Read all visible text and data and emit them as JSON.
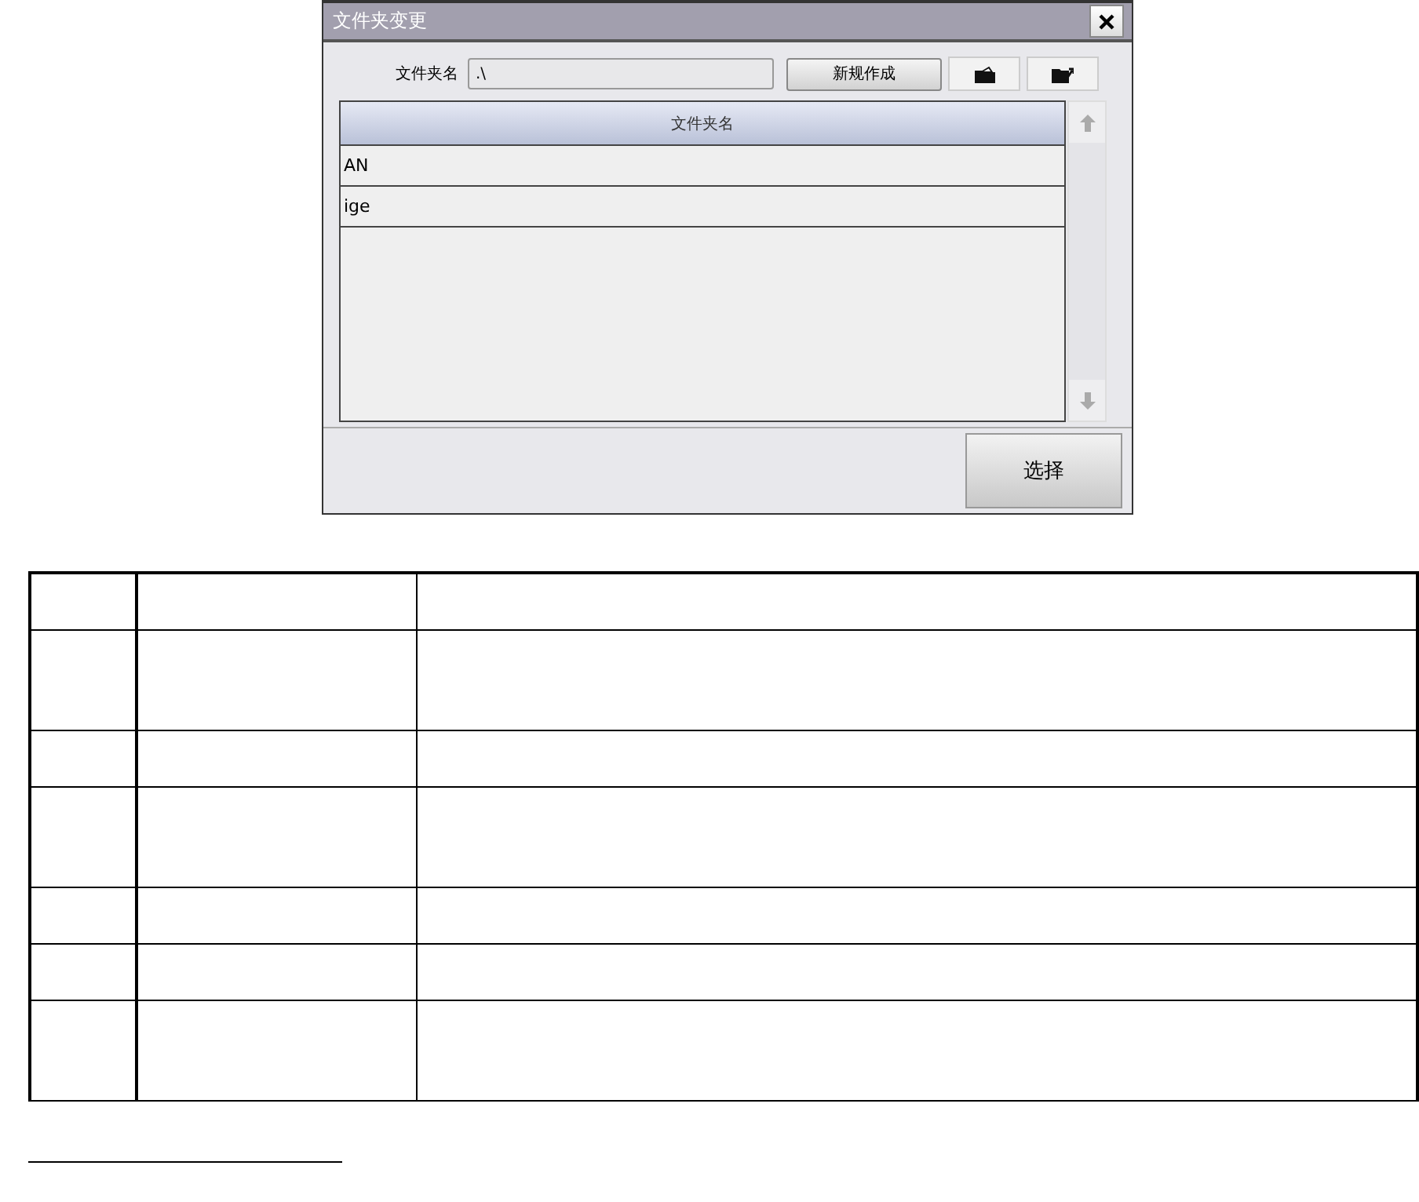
{
  "dialog": {
    "title": "文件夹变更",
    "field_label": "文件夹名",
    "field_value": ".\\",
    "new_button": "新规作成",
    "list_header": "文件夹名",
    "rows": [
      {
        "name": "AN"
      },
      {
        "name": "ige"
      }
    ],
    "select_button": "选择"
  },
  "doc_table": {
    "rows": [
      {
        "kind": "short"
      },
      {
        "kind": "tall"
      },
      {
        "kind": "short"
      },
      {
        "kind": "tall"
      },
      {
        "kind": "short"
      },
      {
        "kind": "short"
      },
      {
        "kind": "tall"
      }
    ]
  }
}
